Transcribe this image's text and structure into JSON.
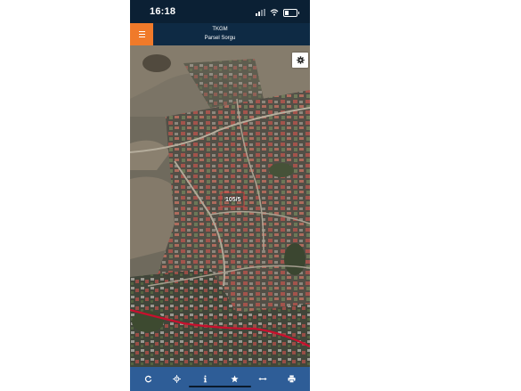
{
  "status_bar": {
    "time": "16:18"
  },
  "header": {
    "title": "TKGM",
    "subtitle": "Parsel Sorgu"
  },
  "map": {
    "parcel_label": "105/5"
  },
  "toolbar": {
    "items": [
      {
        "icon": "refresh-icon"
      },
      {
        "icon": "locate-icon"
      },
      {
        "icon": "info-icon"
      },
      {
        "icon": "star-icon"
      },
      {
        "icon": "measure-icon"
      },
      {
        "icon": "print-icon"
      }
    ]
  },
  "colors": {
    "header_bg": "#0e2a44",
    "menu_button": "#f07a2a",
    "toolbar_bg": "#2e5d97",
    "road_red": "#c8102e"
  }
}
